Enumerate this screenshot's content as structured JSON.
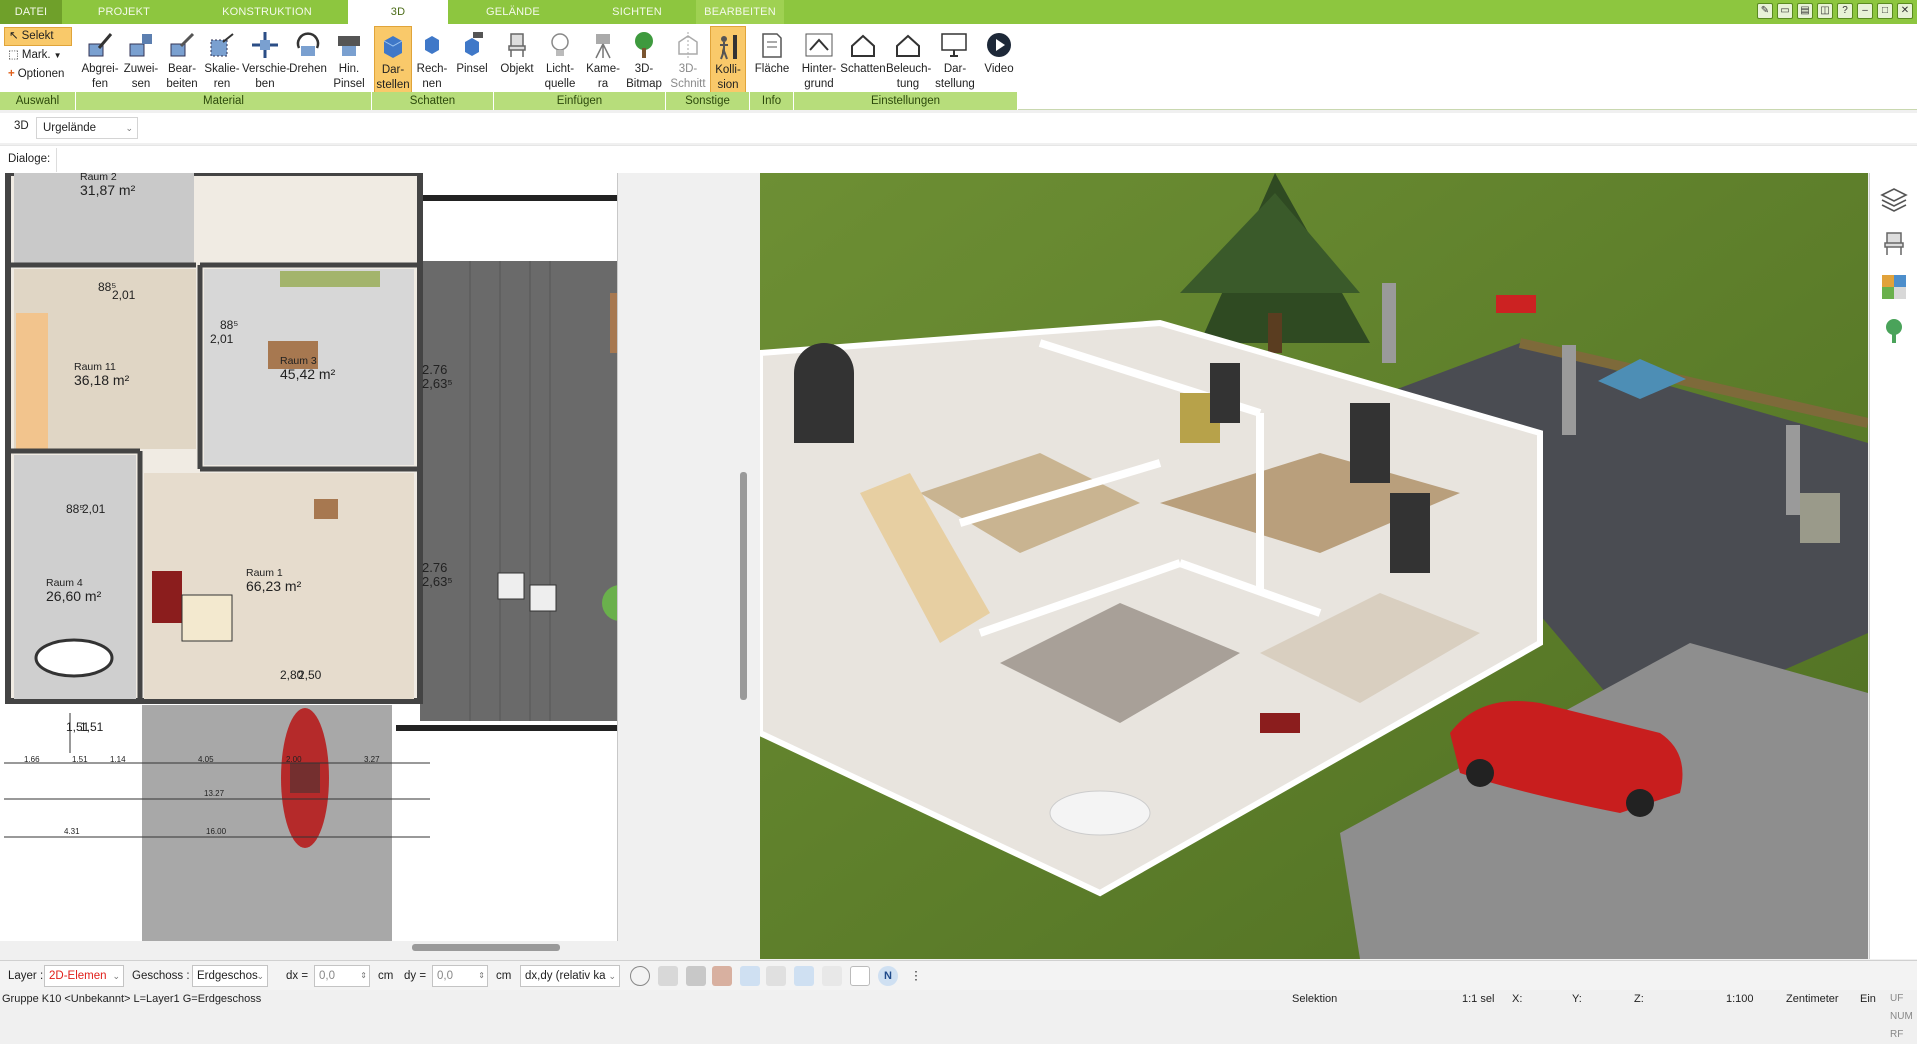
{
  "tabs": [
    {
      "label": "DATEI",
      "active": false
    },
    {
      "label": "PROJEKT",
      "active": false
    },
    {
      "label": "KONSTRUKTION",
      "active": false
    },
    {
      "label": "3D",
      "active": true
    },
    {
      "label": "GELÄNDE",
      "active": false
    },
    {
      "label": "SICHTEN",
      "active": false
    },
    {
      "label": "BEARBEITEN",
      "active": false
    }
  ],
  "selection": {
    "select_label": "Selekt",
    "mark_label": "Mark.",
    "options_label": "Optionen"
  },
  "ribbon": {
    "buttons": [
      {
        "label": "Abgrei-\nfen",
        "icon": "eyedropper-icon"
      },
      {
        "label": "Zuwei-\nsen",
        "icon": "assign-material-icon"
      },
      {
        "label": "Bear-\nbeiten",
        "icon": "edit-material-icon"
      },
      {
        "label": "Skalie-\nren",
        "icon": "scale-icon"
      },
      {
        "label": "Verschie-\nben",
        "icon": "move-icon"
      },
      {
        "label": "Drehen",
        "icon": "rotate-icon"
      },
      {
        "label": "Hin.\nPinsel",
        "icon": "brush-icon"
      },
      {
        "label": "Dar-\nstellen",
        "icon": "shadow-display-icon"
      },
      {
        "label": "Rech-\nnen",
        "icon": "shadow-calc-icon"
      },
      {
        "label": "Pinsel",
        "icon": "shadow-brush-icon"
      },
      {
        "label": "Objekt",
        "icon": "chair-icon"
      },
      {
        "label": "Licht-\nquelle",
        "icon": "light-bulb-icon"
      },
      {
        "label": "Kame-\nra",
        "icon": "camera-icon"
      },
      {
        "label": "3D-\nBitmap",
        "icon": "tree-icon"
      },
      {
        "label": "3D-\nSchnitt",
        "icon": "section-icon"
      },
      {
        "label": "Kolli-\nsion",
        "icon": "collision-icon"
      },
      {
        "label": "Fläche",
        "icon": "area-info-icon"
      },
      {
        "label": "Hinter-\ngrund",
        "icon": "background-icon"
      },
      {
        "label": "Schatten",
        "icon": "shadow-settings-icon"
      },
      {
        "label": "Beleuch-\ntung",
        "icon": "lighting-icon"
      },
      {
        "label": "Dar-\nstellung",
        "icon": "display-icon"
      },
      {
        "label": "Video",
        "icon": "play-icon"
      }
    ],
    "groups": [
      "Auswahl",
      "Material",
      "Schatten",
      "Einfügen",
      "Sonstige",
      "Info",
      "Einstellungen"
    ]
  },
  "view": {
    "mode_label": "3D",
    "layer_value": "Urgelände",
    "dialog_label": "Dialoge:"
  },
  "plan": {
    "rooms": [
      {
        "name": "Raum 2",
        "area": "31,87 m²"
      },
      {
        "name": "Raum 11",
        "area": "36,18 m²"
      },
      {
        "name": "Raum 3",
        "area": "45,42 m²"
      },
      {
        "name": "Raum 4",
        "area": "26,60 m²"
      },
      {
        "name": "Raum 1",
        "area": "66,23 m²"
      }
    ],
    "dims": [
      "88⁵",
      "2,01",
      "88⁵",
      "2,01",
      "88⁵",
      "2,01",
      "2.76",
      "2,63⁵",
      "2.76",
      "2,63⁵",
      "2,80",
      "2,50",
      "1,51",
      "1,51"
    ],
    "bottom_dims": [
      "1.66",
      "1.51",
      "1.14",
      "4.05",
      "2.00",
      "3.27",
      "13.27",
      "4.31",
      "16.00"
    ]
  },
  "bottombar": {
    "layer_label": "Layer :",
    "layer_value": "2D-Elemen",
    "floor_label": "Geschoss :",
    "floor_value": "Erdgeschos",
    "dx_label": "dx =",
    "dx_value": "0,0",
    "unit1": "cm",
    "dy_label": "dy =",
    "dy_value": "0,0",
    "unit2": "cm",
    "mode_value": "dx,dy (relativ ka"
  },
  "status": {
    "group": "Gruppe K10 <Unbekannt> L=Layer1 G=Erdgeschoss",
    "mode": "Selektion",
    "sel": "1:1 sel",
    "x": "X:",
    "y": "Y:",
    "z": "Z:",
    "scale": "1:100",
    "unit": "Zentimeter",
    "snap": "Ein",
    "flags": "UF NUM RF"
  },
  "colors": {
    "accent_green": "#8dc63f",
    "group_green": "#b7dd7b",
    "selected_orange": "#f9c96a",
    "layer_red": "#e0201b"
  }
}
